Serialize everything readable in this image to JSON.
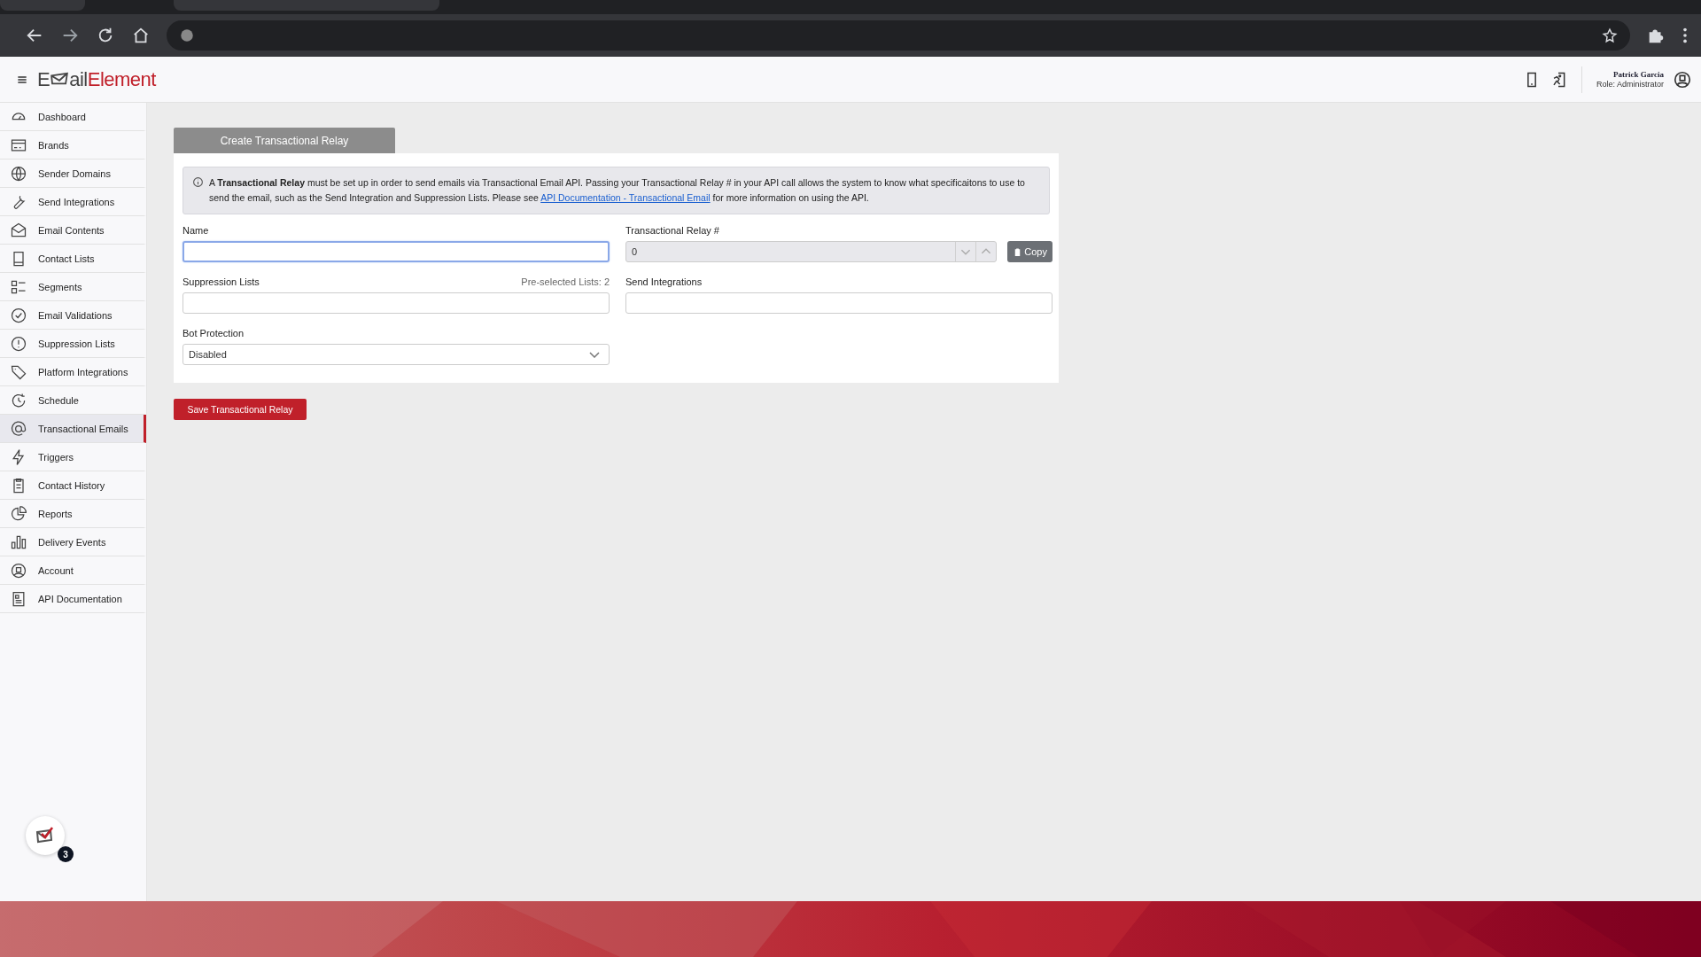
{
  "logo": {
    "first": "E",
    "rest": "ail",
    "accent": "Element"
  },
  "user": {
    "name": "Patrick Garcia",
    "role": "Role: Administrator"
  },
  "sidebar": {
    "items": [
      {
        "label": "Dashboard",
        "selected": false
      },
      {
        "label": "Brands",
        "selected": false
      },
      {
        "label": "Sender Domains",
        "selected": false
      },
      {
        "label": "Send Integrations",
        "selected": false
      },
      {
        "label": "Email Contents",
        "selected": false
      },
      {
        "label": "Contact Lists",
        "selected": false
      },
      {
        "label": "Segments",
        "selected": false
      },
      {
        "label": "Email Validations",
        "selected": false
      },
      {
        "label": "Suppression Lists",
        "selected": false
      },
      {
        "label": "Platform Integrations",
        "selected": false
      },
      {
        "label": "Schedule",
        "selected": false
      },
      {
        "label": "Transactional Emails",
        "selected": true
      },
      {
        "label": "Triggers",
        "selected": false
      },
      {
        "label": "Contact History",
        "selected": false
      },
      {
        "label": "Reports",
        "selected": false
      },
      {
        "label": "Delivery Events",
        "selected": false
      },
      {
        "label": "Account",
        "selected": false
      },
      {
        "label": "API Documentation",
        "selected": false
      }
    ]
  },
  "tab": {
    "label": "Create Transactional Relay"
  },
  "info": {
    "text": "A **Transactional Relay** must be set up in order to send emails via Transactional Email API. Passing your Transactional Relay # in your API call allows the system to know what specificaitons to use to send the email, such as the Send Integration and Suppression Lists. Please see",
    "link": "API Documentation - Transactional Email",
    "after": "for more information on using the API."
  },
  "form": {
    "name": {
      "label": "Name",
      "focused": true
    },
    "relay": {
      "label": "Transactional Relay #",
      "value": "0",
      "copy": "Copy"
    },
    "suppression": {
      "label": "Suppression Lists",
      "hint": "Pre-selected Lists: 2"
    },
    "send_integrations": {
      "label": "Send Integrations"
    },
    "bot": {
      "label": "Bot Protection",
      "value": "Disabled"
    }
  },
  "save_button": "Save Transactional Relay",
  "notifications": {
    "count": "3"
  }
}
